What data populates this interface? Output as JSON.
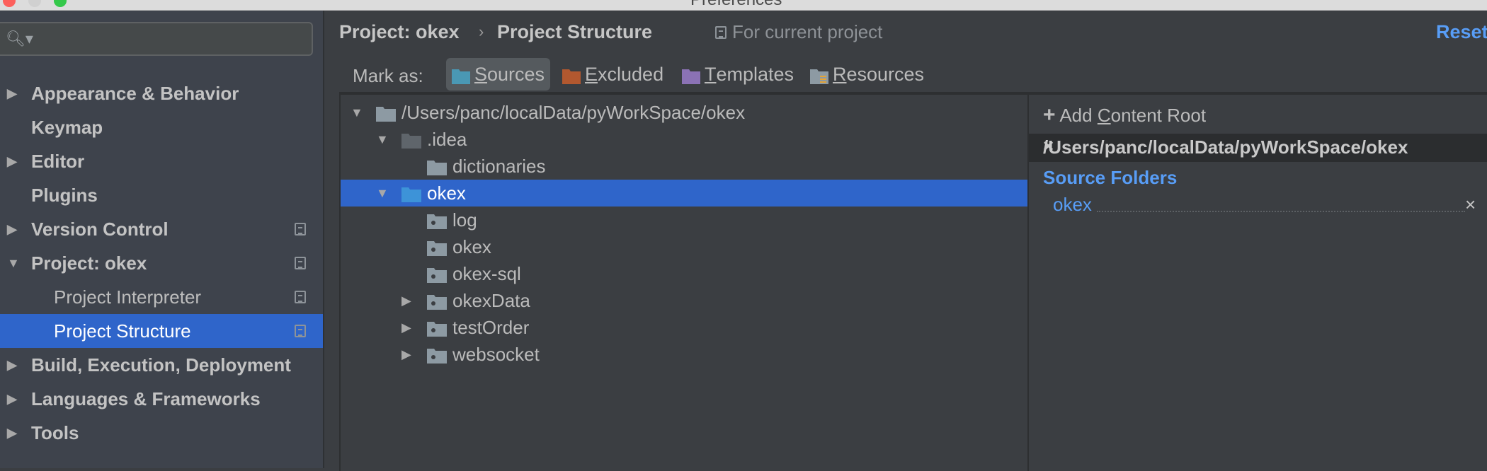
{
  "window": {
    "title": "Preferences"
  },
  "sidebar": {
    "search": {
      "placeholder": "",
      "icon": "search-icon"
    },
    "items": [
      {
        "label": "Appearance & Behavior",
        "expandable": true,
        "expanded": false,
        "bold": true,
        "project_scope": false
      },
      {
        "label": "Keymap",
        "expandable": false,
        "bold": true,
        "project_scope": false
      },
      {
        "label": "Editor",
        "expandable": true,
        "expanded": false,
        "bold": true,
        "project_scope": false
      },
      {
        "label": "Plugins",
        "expandable": false,
        "bold": true,
        "project_scope": false
      },
      {
        "label": "Version Control",
        "expandable": true,
        "expanded": false,
        "bold": true,
        "project_scope": true
      },
      {
        "label": "Project: okex",
        "expandable": true,
        "expanded": true,
        "bold": true,
        "project_scope": true
      },
      {
        "label": "Project Interpreter",
        "expandable": false,
        "bold": false,
        "project_scope": true,
        "child": true
      },
      {
        "label": "Project Structure",
        "expandable": false,
        "bold": false,
        "project_scope": true,
        "child": true,
        "selected": true
      },
      {
        "label": "Build, Execution, Deployment",
        "expandable": true,
        "expanded": false,
        "bold": true,
        "project_scope": false
      },
      {
        "label": "Languages & Frameworks",
        "expandable": true,
        "expanded": false,
        "bold": true,
        "project_scope": false
      },
      {
        "label": "Tools",
        "expandable": true,
        "expanded": false,
        "bold": true,
        "project_scope": false
      }
    ]
  },
  "header": {
    "breadcrumb": [
      "Project: okex",
      "Project Structure"
    ],
    "separator": "›",
    "scope_note": "For current project",
    "reset_label": "Reset"
  },
  "mark_as": {
    "label": "Mark as:",
    "buttons": [
      {
        "label": "Sources",
        "mnemonic": "S",
        "rest": "ources",
        "color": "#4a98b4",
        "active": true
      },
      {
        "label": "Excluded",
        "mnemonic": "E",
        "rest": "xcluded",
        "color": "#b2582f",
        "active": false
      },
      {
        "label": "Templates",
        "mnemonic": "T",
        "rest": "emplates",
        "color": "#8b72b5",
        "active": false
      },
      {
        "label": "Resources",
        "mnemonic": "R",
        "rest": "esources",
        "color": "#8d9aa3",
        "active": false
      }
    ]
  },
  "tree": {
    "rows": [
      {
        "label": "/Users/panc/localData/pyWorkSpace/okex",
        "depth": 0,
        "arrow": "down",
        "folder": "plain"
      },
      {
        "label": ".idea",
        "depth": 1,
        "arrow": "down",
        "folder": "dark"
      },
      {
        "label": "dictionaries",
        "depth": 2,
        "arrow": "none",
        "folder": "plain"
      },
      {
        "label": "okex",
        "depth": 1,
        "arrow": "down",
        "folder": "source",
        "selected": true
      },
      {
        "label": "log",
        "depth": 2,
        "arrow": "none",
        "folder": "package"
      },
      {
        "label": "okex",
        "depth": 2,
        "arrow": "none",
        "folder": "package"
      },
      {
        "label": "okex-sql",
        "depth": 2,
        "arrow": "none",
        "folder": "package"
      },
      {
        "label": "okexData",
        "depth": 2,
        "arrow": "right",
        "folder": "package"
      },
      {
        "label": "testOrder",
        "depth": 2,
        "arrow": "right",
        "folder": "package"
      },
      {
        "label": "websocket",
        "depth": 2,
        "arrow": "right",
        "folder": "package"
      }
    ]
  },
  "content_root": {
    "add_label_pre": "Add ",
    "add_mnemonic": "C",
    "add_label_post": "ontent Root",
    "path": "/Users/panc/localData/pyWorkSpace/okex",
    "source_folders_title": "Source Folders",
    "source_folders": [
      "okex"
    ],
    "remove_icon": "×"
  }
}
